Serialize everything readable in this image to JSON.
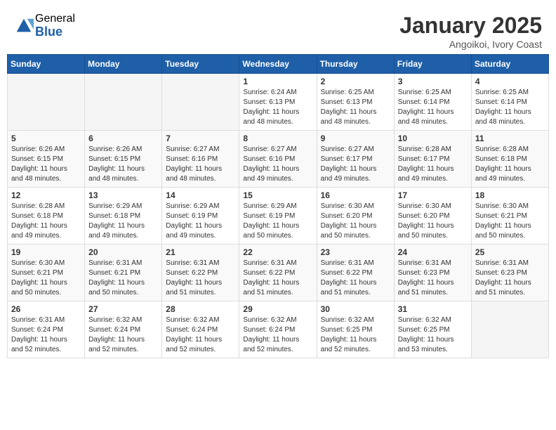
{
  "header": {
    "logo_general": "General",
    "logo_blue": "Blue",
    "month": "January 2025",
    "location": "Angoikoi, Ivory Coast"
  },
  "weekdays": [
    "Sunday",
    "Monday",
    "Tuesday",
    "Wednesday",
    "Thursday",
    "Friday",
    "Saturday"
  ],
  "weeks": [
    [
      {
        "day": "",
        "info": ""
      },
      {
        "day": "",
        "info": ""
      },
      {
        "day": "",
        "info": ""
      },
      {
        "day": "1",
        "info": "Sunrise: 6:24 AM\nSunset: 6:13 PM\nDaylight: 11 hours\nand 48 minutes."
      },
      {
        "day": "2",
        "info": "Sunrise: 6:25 AM\nSunset: 6:13 PM\nDaylight: 11 hours\nand 48 minutes."
      },
      {
        "day": "3",
        "info": "Sunrise: 6:25 AM\nSunset: 6:14 PM\nDaylight: 11 hours\nand 48 minutes."
      },
      {
        "day": "4",
        "info": "Sunrise: 6:25 AM\nSunset: 6:14 PM\nDaylight: 11 hours\nand 48 minutes."
      }
    ],
    [
      {
        "day": "5",
        "info": "Sunrise: 6:26 AM\nSunset: 6:15 PM\nDaylight: 11 hours\nand 48 minutes."
      },
      {
        "day": "6",
        "info": "Sunrise: 6:26 AM\nSunset: 6:15 PM\nDaylight: 11 hours\nand 48 minutes."
      },
      {
        "day": "7",
        "info": "Sunrise: 6:27 AM\nSunset: 6:16 PM\nDaylight: 11 hours\nand 48 minutes."
      },
      {
        "day": "8",
        "info": "Sunrise: 6:27 AM\nSunset: 6:16 PM\nDaylight: 11 hours\nand 49 minutes."
      },
      {
        "day": "9",
        "info": "Sunrise: 6:27 AM\nSunset: 6:17 PM\nDaylight: 11 hours\nand 49 minutes."
      },
      {
        "day": "10",
        "info": "Sunrise: 6:28 AM\nSunset: 6:17 PM\nDaylight: 11 hours\nand 49 minutes."
      },
      {
        "day": "11",
        "info": "Sunrise: 6:28 AM\nSunset: 6:18 PM\nDaylight: 11 hours\nand 49 minutes."
      }
    ],
    [
      {
        "day": "12",
        "info": "Sunrise: 6:28 AM\nSunset: 6:18 PM\nDaylight: 11 hours\nand 49 minutes."
      },
      {
        "day": "13",
        "info": "Sunrise: 6:29 AM\nSunset: 6:18 PM\nDaylight: 11 hours\nand 49 minutes."
      },
      {
        "day": "14",
        "info": "Sunrise: 6:29 AM\nSunset: 6:19 PM\nDaylight: 11 hours\nand 49 minutes."
      },
      {
        "day": "15",
        "info": "Sunrise: 6:29 AM\nSunset: 6:19 PM\nDaylight: 11 hours\nand 50 minutes."
      },
      {
        "day": "16",
        "info": "Sunrise: 6:30 AM\nSunset: 6:20 PM\nDaylight: 11 hours\nand 50 minutes."
      },
      {
        "day": "17",
        "info": "Sunrise: 6:30 AM\nSunset: 6:20 PM\nDaylight: 11 hours\nand 50 minutes."
      },
      {
        "day": "18",
        "info": "Sunrise: 6:30 AM\nSunset: 6:21 PM\nDaylight: 11 hours\nand 50 minutes."
      }
    ],
    [
      {
        "day": "19",
        "info": "Sunrise: 6:30 AM\nSunset: 6:21 PM\nDaylight: 11 hours\nand 50 minutes."
      },
      {
        "day": "20",
        "info": "Sunrise: 6:31 AM\nSunset: 6:21 PM\nDaylight: 11 hours\nand 50 minutes."
      },
      {
        "day": "21",
        "info": "Sunrise: 6:31 AM\nSunset: 6:22 PM\nDaylight: 11 hours\nand 51 minutes."
      },
      {
        "day": "22",
        "info": "Sunrise: 6:31 AM\nSunset: 6:22 PM\nDaylight: 11 hours\nand 51 minutes."
      },
      {
        "day": "23",
        "info": "Sunrise: 6:31 AM\nSunset: 6:22 PM\nDaylight: 11 hours\nand 51 minutes."
      },
      {
        "day": "24",
        "info": "Sunrise: 6:31 AM\nSunset: 6:23 PM\nDaylight: 11 hours\nand 51 minutes."
      },
      {
        "day": "25",
        "info": "Sunrise: 6:31 AM\nSunset: 6:23 PM\nDaylight: 11 hours\nand 51 minutes."
      }
    ],
    [
      {
        "day": "26",
        "info": "Sunrise: 6:31 AM\nSunset: 6:24 PM\nDaylight: 11 hours\nand 52 minutes."
      },
      {
        "day": "27",
        "info": "Sunrise: 6:32 AM\nSunset: 6:24 PM\nDaylight: 11 hours\nand 52 minutes."
      },
      {
        "day": "28",
        "info": "Sunrise: 6:32 AM\nSunset: 6:24 PM\nDaylight: 11 hours\nand 52 minutes."
      },
      {
        "day": "29",
        "info": "Sunrise: 6:32 AM\nSunset: 6:24 PM\nDaylight: 11 hours\nand 52 minutes."
      },
      {
        "day": "30",
        "info": "Sunrise: 6:32 AM\nSunset: 6:25 PM\nDaylight: 11 hours\nand 52 minutes."
      },
      {
        "day": "31",
        "info": "Sunrise: 6:32 AM\nSunset: 6:25 PM\nDaylight: 11 hours\nand 53 minutes."
      },
      {
        "day": "",
        "info": ""
      }
    ]
  ]
}
